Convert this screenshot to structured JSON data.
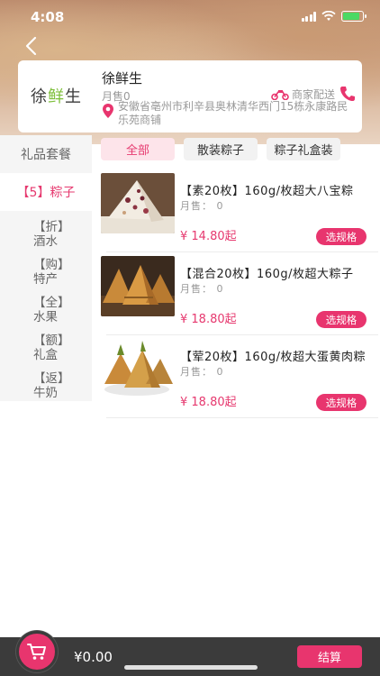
{
  "status_bar": {
    "time": "4:08",
    "battery_level": 0.85
  },
  "shop": {
    "logo_text_1": "徐",
    "logo_text_2": "鲜",
    "logo_text_3": "生",
    "name": "徐鲜生",
    "sales": "月售0",
    "delivery": "商家配送",
    "address": "安徽省亳州市利辛县奥林清华西门15栋永康路民乐苑商铺"
  },
  "sidebar": {
    "items": [
      {
        "label": "礼品套餐",
        "active": false
      },
      {
        "label": "【5】粽子",
        "active": true
      },
      {
        "line1": "【折】",
        "line2": "酒水"
      },
      {
        "line1": "【购】",
        "line2": "特产"
      },
      {
        "line1": "【全】",
        "line2": "水果"
      },
      {
        "line1": "【额】",
        "line2": "礼盒"
      },
      {
        "line1": "【返】",
        "line2": "牛奶"
      }
    ]
  },
  "filters": [
    {
      "label": "全部",
      "active": true
    },
    {
      "label": "散装粽子",
      "active": false
    },
    {
      "label": "粽子礼盒装",
      "active": false
    }
  ],
  "products": [
    {
      "title": "【素20枚】160g/枚超大八宝粽",
      "sold": "月售： 0",
      "price": "¥ 14.80起",
      "button": "选规格"
    },
    {
      "title": "【混合20枚】160g/枚超大粽子",
      "sold": "月售： 0",
      "price": "¥ 18.80起",
      "button": "选规格"
    },
    {
      "title": "【荤20枚】160g/枚超大蛋黄肉粽",
      "sold": "月售： 0",
      "price": "¥ 18.80起",
      "button": "选规格"
    }
  ],
  "cart": {
    "total": "¥0.00",
    "checkout": "结算"
  },
  "colors": {
    "accent": "#e8356e",
    "bar": "#3b3b3b"
  }
}
